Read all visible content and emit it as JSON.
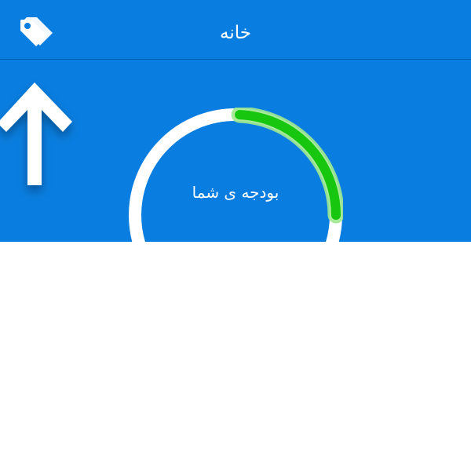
{
  "header": {
    "title": "خانه",
    "tags_icon": "tags-icon"
  },
  "main": {
    "budget_label": "بودجه ی شما",
    "arrow_icon": "up-arrow-icon",
    "budget_progress_fraction": 0.25
  },
  "colors": {
    "accent_blue": "#0a7ee0",
    "progress_green": "#16c60f",
    "ring_white": "#ffffff"
  }
}
